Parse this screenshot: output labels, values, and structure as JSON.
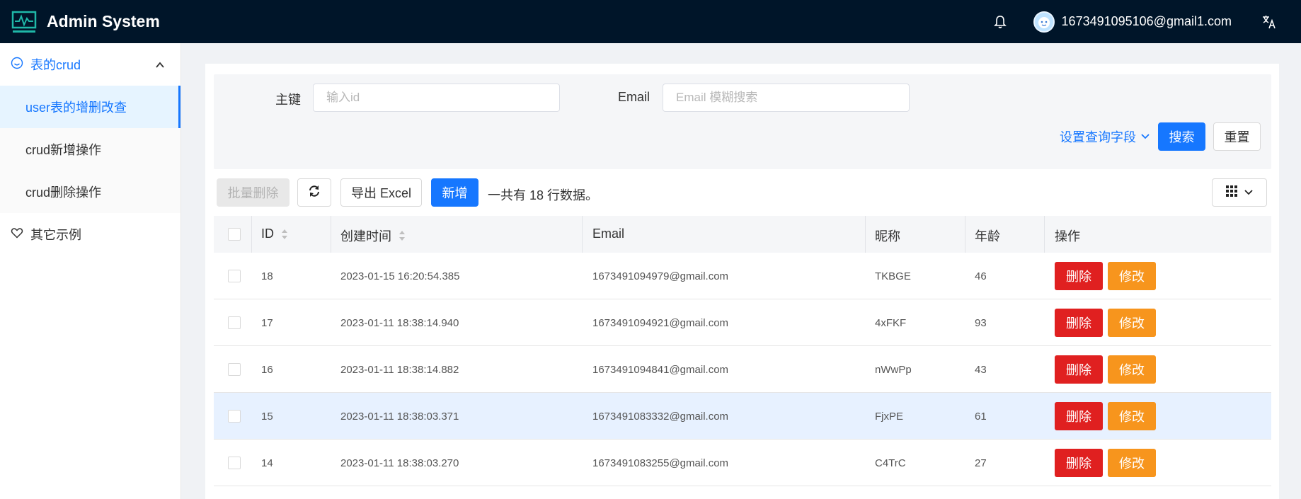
{
  "app": {
    "title": "Admin System"
  },
  "header": {
    "user_email": "1673491095106@gmail1.com"
  },
  "sidebar": {
    "group": {
      "label": "表的crud"
    },
    "items": [
      {
        "label": "user表的增删改查"
      },
      {
        "label": "crud新增操作"
      },
      {
        "label": "crud删除操作"
      }
    ],
    "other": {
      "label": "其它示例"
    }
  },
  "search": {
    "id_label": "主键",
    "id_placeholder": "输入id",
    "email_label": "Email",
    "email_placeholder": "Email 模糊搜索",
    "fields_link": "设置查询字段",
    "search_button": "搜索",
    "reset_button": "重置"
  },
  "toolbar": {
    "batch_delete": "批量删除",
    "export": "导出 Excel",
    "add": "新增",
    "count_text": "一共有 18 行数据。"
  },
  "table": {
    "headers": {
      "id": "ID",
      "created": "创建时间",
      "email": "Email",
      "nickname": "昵称",
      "age": "年龄",
      "actions": "操作"
    },
    "delete_label": "删除",
    "edit_label": "修改",
    "rows": [
      {
        "id": "18",
        "created": "2023-01-15 16:20:54.385",
        "email": "1673491094979@gmail.com",
        "nickname": "TKBGE",
        "age": "46"
      },
      {
        "id": "17",
        "created": "2023-01-11 18:38:14.940",
        "email": "1673491094921@gmail.com",
        "nickname": "4xFKF",
        "age": "93"
      },
      {
        "id": "16",
        "created": "2023-01-11 18:38:14.882",
        "email": "1673491094841@gmail.com",
        "nickname": "nWwPp",
        "age": "43"
      },
      {
        "id": "15",
        "created": "2023-01-11 18:38:03.371",
        "email": "1673491083332@gmail.com",
        "nickname": "FjxPE",
        "age": "61"
      },
      {
        "id": "14",
        "created": "2023-01-11 18:38:03.270",
        "email": "1673491083255@gmail.com",
        "nickname": "C4TrC",
        "age": "27"
      }
    ]
  },
  "colors": {
    "brand": "#1677ff",
    "header_bg": "#001529",
    "danger": "#e02020",
    "warning": "#f7951d",
    "row_hover": "#e7f1ff"
  }
}
